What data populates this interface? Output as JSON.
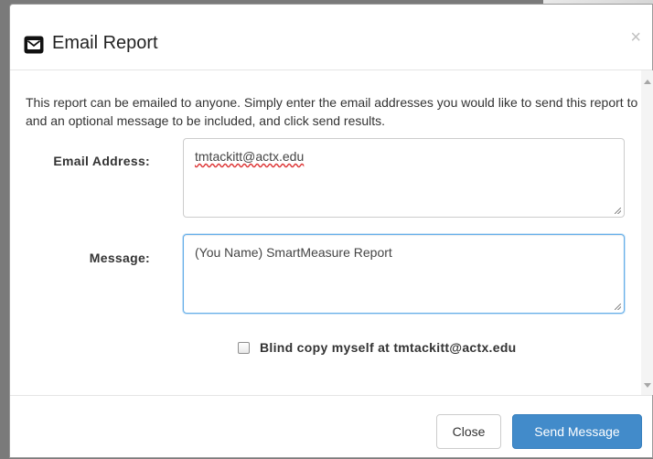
{
  "dialog": {
    "title": "Email Report",
    "close_glyph": "×",
    "icon": "envelope-icon"
  },
  "body": {
    "intro": "This report can be emailed to anyone. Simply enter the email addresses you would like to send this report to and an optional message to be included, and click send results.",
    "email_label": "Email Address:",
    "email_value": "tmtackitt@actx.edu",
    "message_label": "Message:",
    "message_value": "(You Name) SmartMeasure Report",
    "checkbox_label": "Blind copy myself at tmtackitt@actx.edu",
    "checkbox_checked": false
  },
  "footer": {
    "close_label": "Close",
    "send_label": "Send Message"
  },
  "colors": {
    "primary": "#428bca",
    "focus_border": "#66afe9"
  }
}
